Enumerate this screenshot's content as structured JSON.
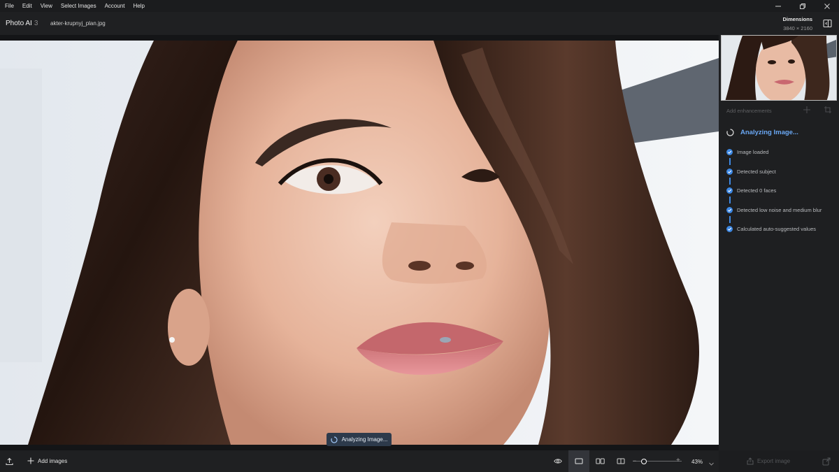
{
  "menu": [
    "File",
    "Edit",
    "View",
    "Select Images",
    "Account",
    "Help"
  ],
  "window": {
    "minimize_icon": "minimize-icon",
    "restore_icon": "restore-icon",
    "close_icon": "close-icon"
  },
  "header": {
    "app_name": "Photo AI",
    "app_version": "3",
    "filename": "akter-krupnyj_plan.jpg",
    "dimensions_label": "Dimensions",
    "dimensions_value": "3840 × 2160"
  },
  "canvas": {
    "toast": "Analyzing Image..."
  },
  "side": {
    "add_enhancements": "Add enhancements",
    "analyzing_title": "Analyzing Image...",
    "steps": [
      "Image loaded",
      "Detected subject",
      "Detected 0 faces",
      "Detected low noise and medium blur",
      "Calculated auto-suggested values"
    ]
  },
  "bottom": {
    "add_images": "Add images",
    "zoom": "43%",
    "zoom_level": 0.43,
    "export": "Export image"
  },
  "colors": {
    "accent": "#3d88e3",
    "accent_text": "#6aa8f5",
    "background": "#17181a"
  }
}
